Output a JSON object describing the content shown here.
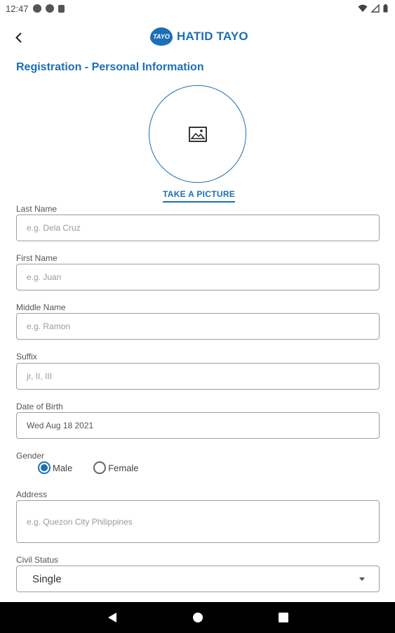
{
  "status_bar": {
    "time": "12:47"
  },
  "header": {
    "logo_text": "TAYO",
    "brand_name": "HATID TAYO"
  },
  "page": {
    "title": "Registration - Personal Information"
  },
  "photo": {
    "take_picture_label": "TAKE A PICTURE"
  },
  "form": {
    "last_name": {
      "label": "Last Name",
      "placeholder": "e.g. Dela Cruz"
    },
    "first_name": {
      "label": "First Name",
      "placeholder": "e.g. Juan"
    },
    "middle_name": {
      "label": "Middle Name",
      "placeholder": "e.g. Ramon"
    },
    "suffix": {
      "label": "Suffix",
      "placeholder": "jr, II, III"
    },
    "date_of_birth": {
      "label": "Date of Birth",
      "value": "Wed Aug 18 2021"
    },
    "gender": {
      "label": "Gender",
      "options": [
        "Male",
        "Female"
      ],
      "selected": "Male"
    },
    "address": {
      "label": "Address",
      "placeholder": "e.g. Quezon City Philippines"
    },
    "civil_status": {
      "label": "Civil Status",
      "value": "Single"
    }
  },
  "colors": {
    "accent": "#1b6fb5",
    "border": "#9e9e9e",
    "nav_bar": "#000000"
  }
}
